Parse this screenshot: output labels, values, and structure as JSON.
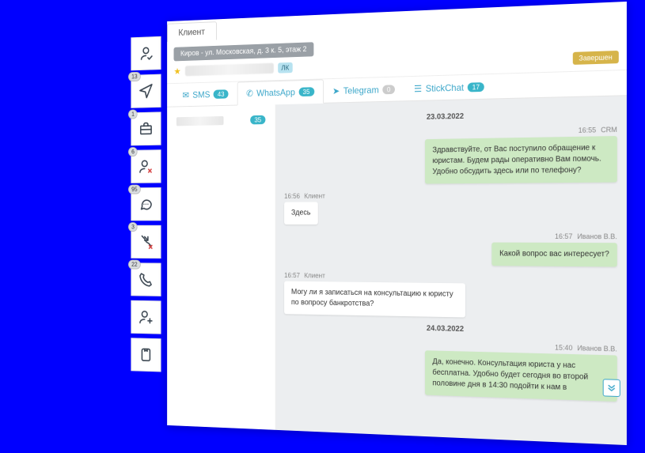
{
  "sidebar": {
    "items": [
      {
        "name": "contacts",
        "badge": ""
      },
      {
        "name": "send",
        "badge": "13"
      },
      {
        "name": "briefcase",
        "badge": "1"
      },
      {
        "name": "user-remove",
        "badge": "6"
      },
      {
        "name": "chat",
        "badge": "95"
      },
      {
        "name": "missed-call",
        "badge": "3"
      },
      {
        "name": "phone",
        "badge": "22"
      },
      {
        "name": "add-user",
        "badge": ""
      },
      {
        "name": "card",
        "badge": ""
      }
    ]
  },
  "topTab": "Клиент",
  "header": {
    "address": "Киров - ул. Московская, д. 3 к. 5, этаж 2",
    "lk": "ЛК",
    "status": "Завершен"
  },
  "channels": [
    {
      "key": "sms",
      "label": "SMS",
      "count": "43",
      "grey": false
    },
    {
      "key": "whatsapp",
      "label": "WhatsApp",
      "count": "35",
      "active": true,
      "grey": false
    },
    {
      "key": "telegram",
      "label": "Telegram",
      "count": "0",
      "grey": true
    },
    {
      "key": "stickchat",
      "label": "StickChat",
      "count": "17",
      "grey": false
    }
  ],
  "thread": {
    "count": "35"
  },
  "chat": {
    "date1": "23.03.2022",
    "date2": "24.03.2022",
    "m1": {
      "time": "16:55",
      "sender": "CRM",
      "text": "Здравствуйте, от Вас поступило обращение к юристам. Будем рады оперативно Вам помочь. Удобно обсудить здесь или по телефону?"
    },
    "m2": {
      "time": "16:56",
      "sender": "Клиент",
      "text": "Здесь"
    },
    "m3": {
      "time": "16:57",
      "sender": "Иванов В.В.",
      "text": "Какой вопрос вас интересует?"
    },
    "m4": {
      "time": "16:57",
      "sender": "Клиент",
      "text": "Могу ли я записаться на консультацию к юристу по вопросу банкротства?"
    },
    "m5": {
      "time": "15:40",
      "sender": "Иванов В.В.",
      "text": "Да, конечно. Консультация юриста у нас бесплатна. Удобно будет сегодня во второй половине дня в 14:30 подойти к нам в"
    }
  }
}
